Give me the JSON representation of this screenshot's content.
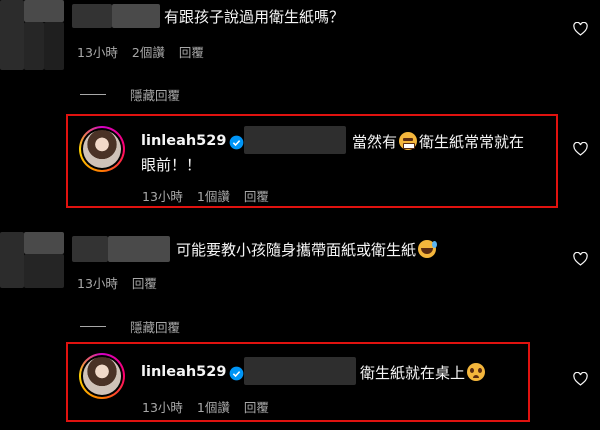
{
  "comments": [
    {
      "text": "有跟孩子說過用衛生紙嗎？",
      "meta": {
        "time": "13小時",
        "likes": "2個讚",
        "reply": "回覆"
      }
    },
    {
      "hide_replies": "隱藏回覆"
    },
    {
      "username": "linleah529",
      "text_line1": "當然有",
      "text_line1b": "衛生紙常常就在",
      "text_line2": "眼前！！",
      "meta": {
        "time": "13小時",
        "likes": "1個讚",
        "reply": "回覆"
      }
    },
    {
      "text": "可能要教小孩隨身攜帶面紙或衛生紙",
      "meta": {
        "time": "13小時",
        "reply": "回覆"
      }
    },
    {
      "hide_replies": "隱藏回覆"
    },
    {
      "username": "linleah529",
      "text": "衛生紙就在桌上",
      "meta": {
        "time": "13小時",
        "likes": "1個讚",
        "reply": "回覆"
      }
    }
  ],
  "icons": {
    "heart": "heart-outline-icon",
    "verified": "verified-badge-icon",
    "emoji_1": "grimacing-face-emoji",
    "emoji_2": "sweat-smile-emoji",
    "emoji_3": "pleading-face-emoji"
  },
  "colors": {
    "background": "#000000",
    "text": "#f5f5f5",
    "secondary": "#a8a8a8",
    "highlight_box": "#e0120f",
    "verified": "#0095f6"
  }
}
